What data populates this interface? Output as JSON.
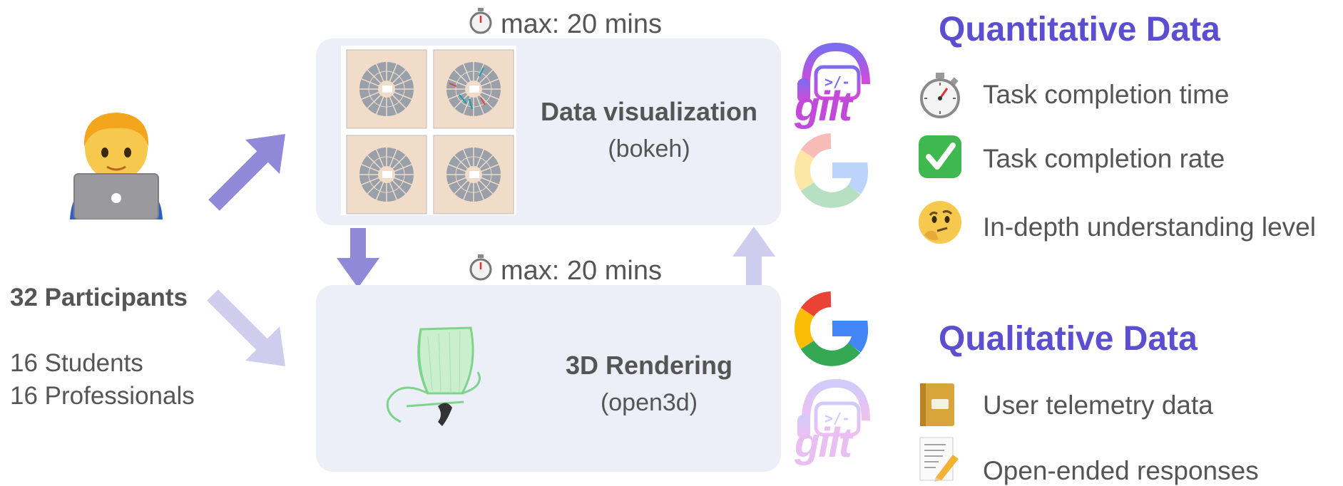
{
  "participants": {
    "total_label": "32 Participants",
    "groups": [
      "16 Students",
      "16 Professionals"
    ]
  },
  "tasks": [
    {
      "time_limit": "max: 20 mins",
      "title": "Data visualization",
      "library": "(bokeh)"
    },
    {
      "time_limit": "max: 20 mins",
      "title": "3D Rendering",
      "library": "(open3d)"
    }
  ],
  "tools": {
    "gilt_label": "gilt"
  },
  "quantitative": {
    "title": "Quantitative Data",
    "items": [
      "Task completion time",
      "Task completion rate",
      "In-depth understanding level"
    ]
  },
  "qualitative": {
    "title": "Qualitative Data",
    "items": [
      "User telemetry data",
      "Open-ended responses"
    ]
  },
  "colors": {
    "accent": "#5b4fd0",
    "panel": "#eceef8",
    "arrow_strong": "#8f89d8",
    "arrow_light": "#cfcdee",
    "text": "#555555"
  },
  "icons": [
    "developer-emoji",
    "stopwatch-icon",
    "check-mark-icon",
    "thinking-face-icon",
    "notebook-icon",
    "memo-icon",
    "google-logo",
    "gilt-logo"
  ]
}
